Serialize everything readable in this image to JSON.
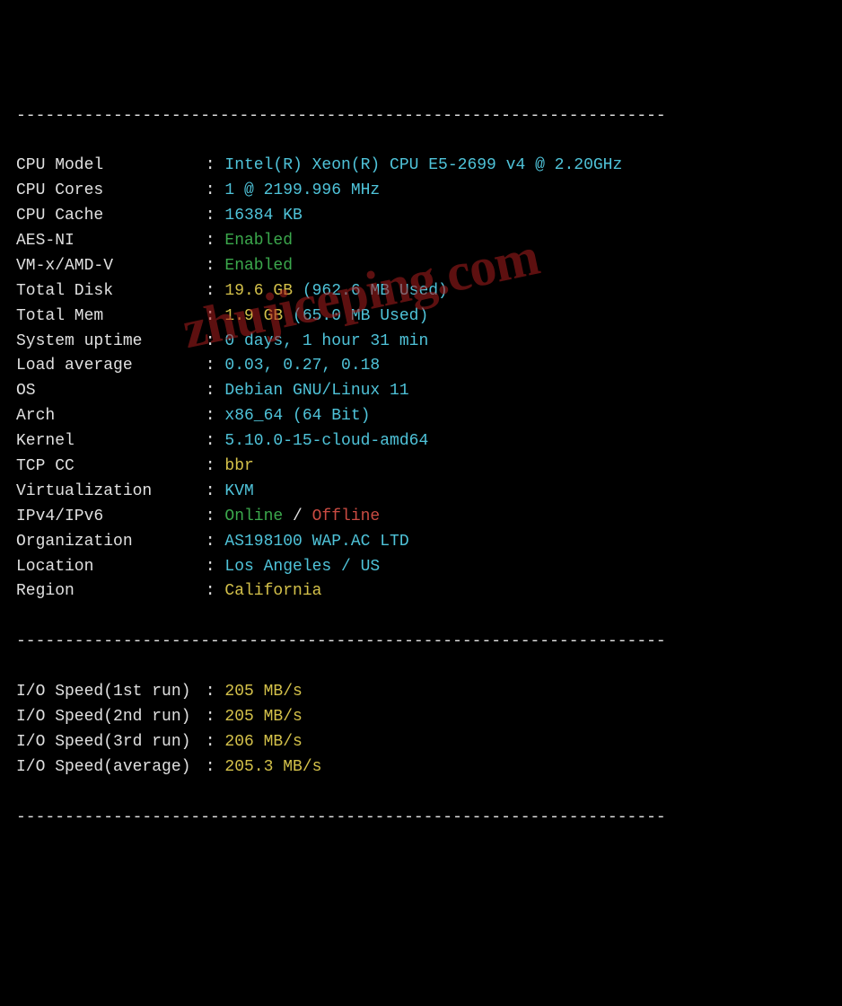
{
  "divider": "-------------------------------------------------------------------",
  "rows": [
    {
      "label": "CPU Model",
      "value_cyan": "Intel(R) Xeon(R) CPU E5-2699 v4 @ 2.20GHz"
    },
    {
      "label": "CPU Cores",
      "value_cyan": "1 @ 2199.996 MHz"
    },
    {
      "label": "CPU Cache",
      "value_cyan": "16384 KB"
    },
    {
      "label": "AES-NI",
      "value_green": "Enabled"
    },
    {
      "label": "VM-x/AMD-V",
      "value_green": "Enabled"
    },
    {
      "label": "Total Disk",
      "value_yellow": "19.6 GB ",
      "value_cyan": "(962.6 MB Used)"
    },
    {
      "label": "Total Mem",
      "value_yellow": "1.9 GB ",
      "value_cyan": "(65.0 MB Used)"
    },
    {
      "label": "System uptime",
      "value_cyan": "0 days, 1 hour 31 min"
    },
    {
      "label": "Load average",
      "value_cyan": "0.03, 0.27, 0.18"
    },
    {
      "label": "OS",
      "value_cyan": "Debian GNU/Linux 11"
    },
    {
      "label": "Arch",
      "value_cyan": "x86_64 (64 Bit)"
    },
    {
      "label": "Kernel",
      "value_cyan": "5.10.0-15-cloud-amd64"
    },
    {
      "label": "TCP CC",
      "value_yellow": "bbr"
    },
    {
      "label": "Virtualization",
      "value_cyan": "KVM"
    },
    {
      "label": "IPv4/IPv6",
      "value_green": "Online",
      "value_sep": " / ",
      "value_red": "Offline"
    },
    {
      "label": "Organization",
      "value_cyan": "AS198100 WAP.AC LTD"
    },
    {
      "label": "Location",
      "value_cyan": "Los Angeles / US"
    },
    {
      "label": "Region",
      "value_yellow": "California"
    }
  ],
  "io": [
    {
      "label": "I/O Speed(1st run)",
      "value": "205 MB/s"
    },
    {
      "label": "I/O Speed(2nd run)",
      "value": "205 MB/s"
    },
    {
      "label": "I/O Speed(3rd run)",
      "value": "206 MB/s"
    },
    {
      "label": "I/O Speed(average)",
      "value": "205.3 MB/s"
    }
  ],
  "watermark": "zhujiceping.com"
}
